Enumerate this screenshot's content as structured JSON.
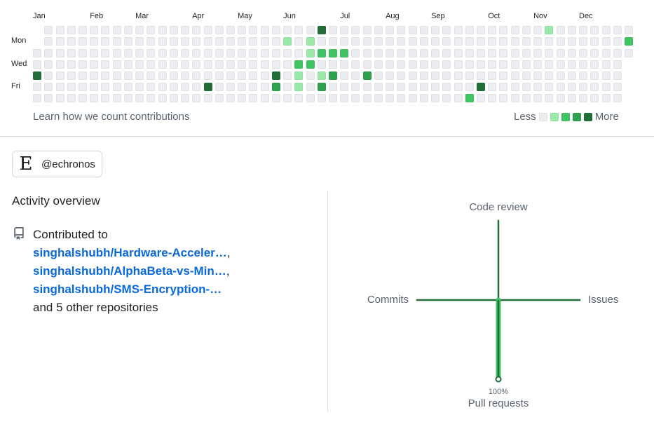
{
  "calendar": {
    "months": [
      "Jan",
      "Feb",
      "Mar",
      "Apr",
      "May",
      "Jun",
      "Jul",
      "Aug",
      "Sep",
      "Oct",
      "Nov",
      "Dec"
    ],
    "month_columns": [
      0,
      5,
      9,
      14,
      18,
      22,
      27,
      31,
      35,
      40,
      44,
      48
    ],
    "day_labels": [
      {
        "row": 1,
        "label": "Mon"
      },
      {
        "row": 3,
        "label": "Wed"
      },
      {
        "row": 5,
        "label": "Fri"
      }
    ],
    "weeks": 53,
    "first_week_start_row": 2,
    "last_week_end_row": 2,
    "level_colors": [
      "#ebedf0",
      "#9be9a8",
      "#40c463",
      "#30a14e",
      "#216e39"
    ],
    "contributions": [
      {
        "col": 0,
        "row": 4,
        "level": 4
      },
      {
        "col": 15,
        "row": 5,
        "level": 4
      },
      {
        "col": 21,
        "row": 4,
        "level": 4
      },
      {
        "col": 21,
        "row": 5,
        "level": 3
      },
      {
        "col": 22,
        "row": 1,
        "level": 1
      },
      {
        "col": 23,
        "row": 3,
        "level": 2
      },
      {
        "col": 23,
        "row": 4,
        "level": 1
      },
      {
        "col": 23,
        "row": 5,
        "level": 1
      },
      {
        "col": 24,
        "row": 1,
        "level": 1
      },
      {
        "col": 24,
        "row": 2,
        "level": 1
      },
      {
        "col": 24,
        "row": 3,
        "level": 2
      },
      {
        "col": 25,
        "row": 0,
        "level": 4
      },
      {
        "col": 25,
        "row": 2,
        "level": 2
      },
      {
        "col": 25,
        "row": 4,
        "level": 1
      },
      {
        "col": 25,
        "row": 5,
        "level": 3
      },
      {
        "col": 26,
        "row": 2,
        "level": 2
      },
      {
        "col": 26,
        "row": 4,
        "level": 3
      },
      {
        "col": 27,
        "row": 2,
        "level": 2
      },
      {
        "col": 29,
        "row": 4,
        "level": 3
      },
      {
        "col": 38,
        "row": 6,
        "level": 2
      },
      {
        "col": 39,
        "row": 5,
        "level": 4
      },
      {
        "col": 45,
        "row": 0,
        "level": 1
      },
      {
        "col": 52,
        "row": 1,
        "level": 2
      }
    ],
    "learn_link": "Learn how we count contributions",
    "legend_less": "Less",
    "legend_more": "More"
  },
  "org": {
    "logo_glyph": "E",
    "name": "@echronos"
  },
  "activity": {
    "title": "Activity overview",
    "contributed_to": "Contributed to",
    "repos": [
      "singhalshubh/Hardware-Acceler…",
      "singhalshubh/AlphaBeta-vs-Min…",
      "singhalshubh/SMS-Encryption-…"
    ],
    "separator": ",",
    "others": "and 5 other repositories"
  },
  "chart_data": {
    "type": "radar",
    "axes": [
      "Code review",
      "Issues",
      "Pull requests",
      "Commits"
    ],
    "values": [
      0,
      0,
      100,
      0
    ],
    "unit": "%",
    "labels_shown": [
      {
        "axis": "Pull requests",
        "value_label": "100%"
      }
    ],
    "colors": {
      "axis": "#216e39",
      "fill": "#40c463"
    }
  }
}
